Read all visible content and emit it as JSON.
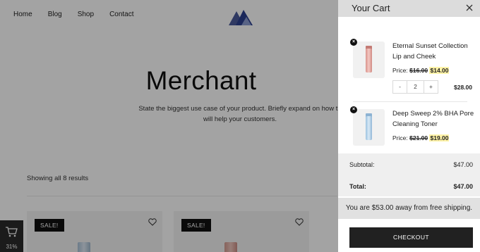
{
  "nav": {
    "items": [
      {
        "label": "Home"
      },
      {
        "label": "Blog"
      },
      {
        "label": "Shop"
      },
      {
        "label": "Contact"
      }
    ],
    "logo_icon": "mountain-logo-icon"
  },
  "hero": {
    "title": "Merchant",
    "subtitle_line1": "State the biggest use case of your product. Briefly expand on how th",
    "subtitle_line2": "will help your customers."
  },
  "shop": {
    "results_text": "Showing all 8 results",
    "cards": [
      {
        "badge": "SALE!",
        "icon": "heart-icon"
      },
      {
        "badge": "SALE!",
        "icon": "heart-icon"
      }
    ]
  },
  "mini_cart": {
    "icon": "cart-icon",
    "progress_text": "31%"
  },
  "cart": {
    "title": "Your Cart",
    "close_icon": "close-icon",
    "items": [
      {
        "name": "Eternal Sunset Collection Lip and Cheek",
        "price_label": "Price:",
        "old_price": "$16.00",
        "new_price": "$14.00",
        "quantity": "2",
        "minus": "-",
        "plus": "+",
        "line_total": "$28.00"
      },
      {
        "name": "Deep Sweep 2% BHA Pore Cleaning Toner",
        "price_label": "Price:",
        "old_price": "$21.00",
        "new_price": "$19.00"
      }
    ],
    "subtotal_label": "Subtotal:",
    "subtotal_value": "$47.00",
    "total_label": "Total:",
    "total_value": "$47.00",
    "shipping_notice": "You are $53.00 away from free shipping.",
    "checkout_label": "CHECKOUT"
  },
  "colors": {
    "overlay": "#000000",
    "checkout_bg": "#212121",
    "highlight": "#fff3a8",
    "header_bg": "#dcdcdc"
  }
}
